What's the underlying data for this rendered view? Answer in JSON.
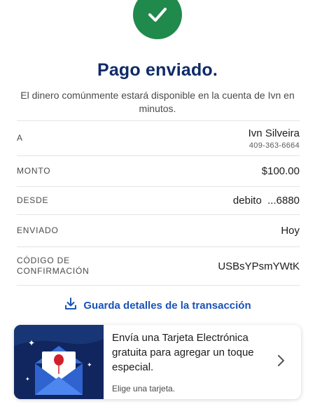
{
  "status": {
    "icon": "checkmark-icon",
    "color": "#1f8a4c"
  },
  "header": {
    "title": "Pago enviado.",
    "subtitle": "El dinero comúnmente estará disponible en la cuenta de Ivn en minutos."
  },
  "details": {
    "to_label": "A",
    "to_name": "Ivn Silveira",
    "to_phone": "409-363-6664",
    "amount_label": "MONTO",
    "amount_value": "$100.00",
    "from_label": "DESDE",
    "from_value": "debito  ...6880",
    "sent_label": "ENVIADO",
    "sent_value": "Hoy",
    "confirmation_label": "CÓDIGO DE CONFIRMACIÓN",
    "confirmation_value": "USBsYPsmYWtK"
  },
  "save_action": {
    "label": "Guarda detalles de la transacción",
    "icon": "download-icon"
  },
  "ecard": {
    "text": "Envía una Tarjeta Electrónica gratuita para agregar un toque especial.",
    "link": "Elige una tarjeta.",
    "icon": "chevron-right-icon"
  },
  "colors": {
    "title": "#0f2a66",
    "link": "#1a52b8",
    "card_art": "#11265e"
  }
}
